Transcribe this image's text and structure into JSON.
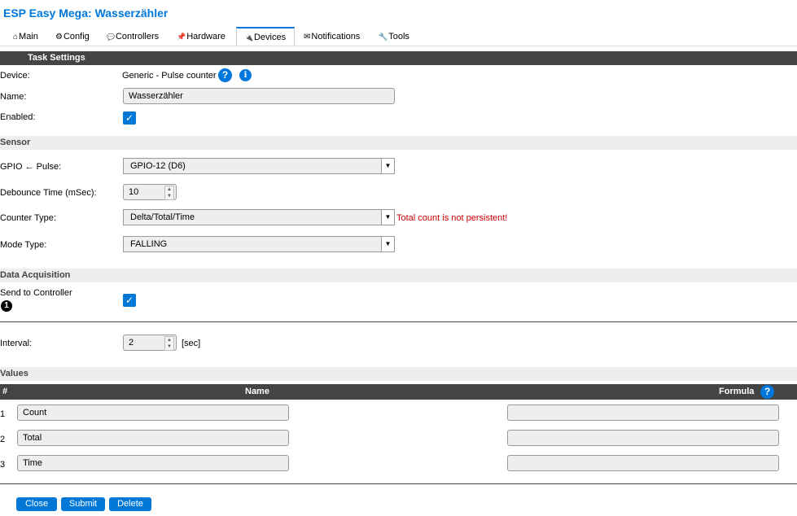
{
  "app_title": "ESP Easy Mega: Wasserzähler",
  "tabs": [
    {
      "icon": "⌂",
      "label": "Main"
    },
    {
      "icon": "⚙",
      "label": "Config"
    },
    {
      "icon": "💬",
      "label": "Controllers"
    },
    {
      "icon": "📌",
      "label": "Hardware"
    },
    {
      "icon": "🔌",
      "label": "Devices"
    },
    {
      "icon": "✉",
      "label": "Notifications"
    },
    {
      "icon": "🔧",
      "label": "Tools"
    }
  ],
  "task_settings": {
    "header": "Task Settings",
    "device_label": "Device:",
    "device_value": "Generic - Pulse counter",
    "help_glyph": "?",
    "info_glyph": "i",
    "name_label": "Name:",
    "name_value": "Wasserzähler",
    "enabled_label": "Enabled:",
    "enabled_checked": true
  },
  "sensor": {
    "header": "Sensor",
    "gpio_label": "GPIO ← Pulse:",
    "gpio_value": "GPIO-12 (D6)",
    "debounce_label": "Debounce Time (mSec):",
    "debounce_value": "10",
    "counter_label": "Counter Type:",
    "counter_value": "Delta/Total/Time",
    "counter_warning": "Total count is not persistent!",
    "mode_label": "Mode Type:",
    "mode_value": "FALLING"
  },
  "data_acquisition": {
    "header": "Data Acquisition",
    "send_label": "Send to Controller",
    "controller_number": "1",
    "send_checked": true,
    "interval_label": "Interval:",
    "interval_value": "2",
    "interval_unit": "[sec]"
  },
  "values": {
    "header": "Values",
    "col_num": "#",
    "col_name": "Name",
    "col_formula": "Formula",
    "help_glyph": "?",
    "rows": [
      {
        "num": "1",
        "name": "Count",
        "formula": ""
      },
      {
        "num": "2",
        "name": "Total",
        "formula": ""
      },
      {
        "num": "3",
        "name": "Time",
        "formula": ""
      }
    ]
  },
  "buttons": {
    "close": "Close",
    "submit": "Submit",
    "delete": "Delete"
  },
  "colors": {
    "accent": "#0078d7",
    "title": "#0077dd",
    "warning": "#cc0000",
    "header_dark": "#444444"
  }
}
